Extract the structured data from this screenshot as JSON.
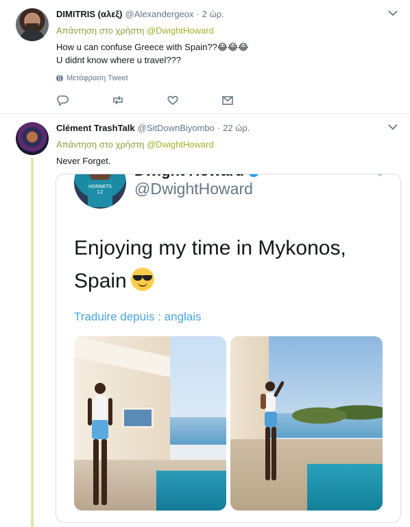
{
  "tweets": [
    {
      "name": "DIMITRIS (αλεξ)",
      "handle": "@Alexandergeox",
      "time": "2 ώρ.",
      "reply_prefix": "Απάντηση στο χρήστη",
      "reply_mention": "@DwightHoward",
      "line1": "How u can confuse Greece with Spain??😂😂😂",
      "line2": "U didnt know where u travel???",
      "translate": "Μετάφραση Tweet"
    },
    {
      "name": "Clément TrashTalk",
      "handle": "@SitDownBiyombo",
      "time": "22 ώρ.",
      "reply_prefix": "Απάντηση στο χρήστη",
      "reply_mention": "@DwightHoward",
      "line1": "Never Forget."
    }
  ],
  "embedded": {
    "name": "Dwight Howard",
    "handle": "@DwightHoward",
    "text_line1": "Enjoying my time in Mykonos,",
    "text_line2": "Spain",
    "translate": "Traduire depuis : anglais",
    "jersey": "HORNETS 12"
  },
  "icons": {
    "reply": "reply-icon",
    "retweet": "retweet-icon",
    "like": "heart-icon",
    "message": "envelope-icon",
    "menu": "chevron-down-icon",
    "translate": "globe-icon"
  },
  "colors": {
    "accent": "#a3b12a",
    "thread": "#e1e8a6",
    "muted": "#657786"
  }
}
